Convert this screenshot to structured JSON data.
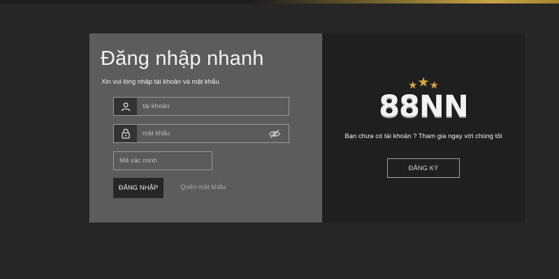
{
  "login": {
    "title": "Đăng nhập nhanh",
    "subtitle": "Xin vui lòng nhập tài khoản và mật khẩu",
    "username_placeholder": "tài khoản",
    "password_placeholder": "mật khẩu",
    "captcha_placeholder": "Mã xác minh",
    "login_button": "ĐĂNG NHẬP",
    "forgot_link": "Quên mật khẩu",
    "icons": {
      "username": "user-icon",
      "password": "lock-icon",
      "toggle": "eye-slash-icon"
    }
  },
  "signup": {
    "logo": "88NN",
    "logo_stars": [
      "★",
      "★",
      "★"
    ],
    "promo": "Bạn chưa có tài khoản ? Tham gia ngay với chúng tôi",
    "register_button": "ĐĂNG KÝ"
  },
  "colors": {
    "page_bg": "#262626",
    "left_panel": "#5c5c5c",
    "right_panel": "#1f1f1f",
    "accent_gold": "#c9a544"
  }
}
